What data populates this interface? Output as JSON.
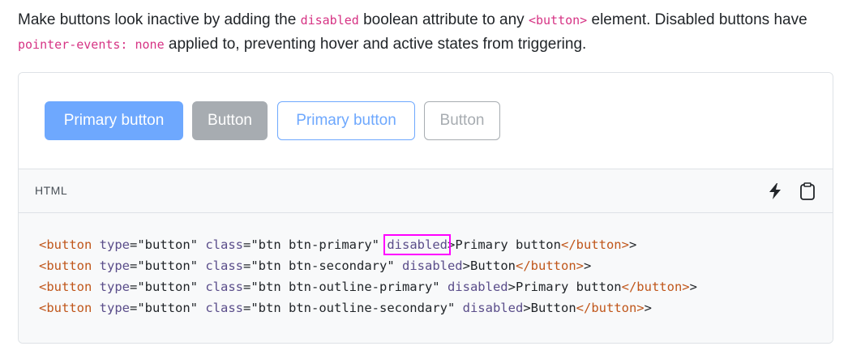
{
  "intro": {
    "text_1": "Make buttons look inactive by adding the ",
    "code_1": "disabled",
    "text_2": " boolean attribute to any ",
    "code_2": "<button>",
    "text_3": " element. Disabled buttons have ",
    "code_3": "pointer-events: none",
    "text_4": " applied to, preventing hover and active states from triggering."
  },
  "preview": {
    "buttons": [
      {
        "label": "Primary button",
        "variant": "btn-primary"
      },
      {
        "label": "Button",
        "variant": "btn-secondary"
      },
      {
        "label": "Primary button",
        "variant": "btn-outline-primary"
      },
      {
        "label": "Button",
        "variant": "btn-outline-secondary"
      }
    ]
  },
  "code_header": {
    "language": "HTML",
    "bolt_icon": "lightning-icon",
    "copy_icon": "clipboard-icon"
  },
  "code": {
    "lines": [
      {
        "open_tag": "<button",
        "attr_type": " type",
        "eq1": "=",
        "val_type": "\"button\"",
        "attr_class": " class",
        "eq2": "=",
        "val_class": "\"btn btn-primary\"",
        "attr_disabled": " disabled",
        "close": ">",
        "text": "Primary button",
        "end_tag": "</button>",
        "end_close": ">"
      },
      {
        "open_tag": "<button",
        "attr_type": " type",
        "eq1": "=",
        "val_type": "\"button\"",
        "attr_class": " class",
        "eq2": "=",
        "val_class": "\"btn btn-secondary\"",
        "attr_disabled": " disabled",
        "close": ">",
        "text": "Button",
        "end_tag": "</button>",
        "end_close": ">"
      },
      {
        "open_tag": "<button",
        "attr_type": " type",
        "eq1": "=",
        "val_type": "\"button\"",
        "attr_class": " class",
        "eq2": "=",
        "val_class": "\"btn btn-outline-primary\"",
        "attr_disabled": " disabled",
        "close": ">",
        "text": "Primary button",
        "end_tag": "</button>",
        "end_close": ">"
      },
      {
        "open_tag": "<button",
        "attr_type": " type",
        "eq1": "=",
        "val_type": "\"button\"",
        "attr_class": " class",
        "eq2": "=",
        "val_class": "\"btn btn-outline-secondary\"",
        "attr_disabled": " disabled",
        "close": ">",
        "text": "Button",
        "end_tag": "</button>",
        "end_close": ">"
      }
    ],
    "highlight_color": "#ff00ff"
  },
  "colors": {
    "primary": "#6ea8fe",
    "secondary": "#a7acb1",
    "inline_code": "#d63384",
    "tag": "#c0561a",
    "attribute": "#5a4d8a"
  }
}
